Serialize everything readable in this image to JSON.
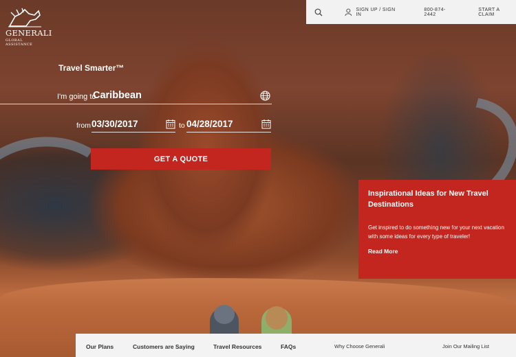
{
  "brand": {
    "name": "GENERALI",
    "subtitle": "GLOBAL ASSISTANCE"
  },
  "topbar": {
    "search_icon": "search-icon",
    "signin_label": "SIGN UP / SIGN IN",
    "phone": "800-874-2442",
    "claim_label": "START A CLAIM"
  },
  "quote": {
    "tagline": "Travel Smarter™",
    "destination_label": "I'm going to",
    "destination_value": "Caribbean",
    "from_label": "from",
    "from_date": "03/30/2017",
    "to_label": "to",
    "to_date": "04/28/2017",
    "button_label": "GET A QUOTE"
  },
  "promo": {
    "title": "Inspirational Ideas for New Travel Destinations",
    "body": "Get inspired to do something new for your next vacation with some ideas for every type of traveler!",
    "link": "Read More"
  },
  "bottom_nav": {
    "items": [
      "Our Plans",
      "Customers are Saying",
      "Travel Resources",
      "FAQs",
      "Why Choose Generali",
      "Join Our Mailing List"
    ]
  },
  "colors": {
    "accent_red": "#c3261e",
    "bar_bg": "#f3f2f2"
  }
}
